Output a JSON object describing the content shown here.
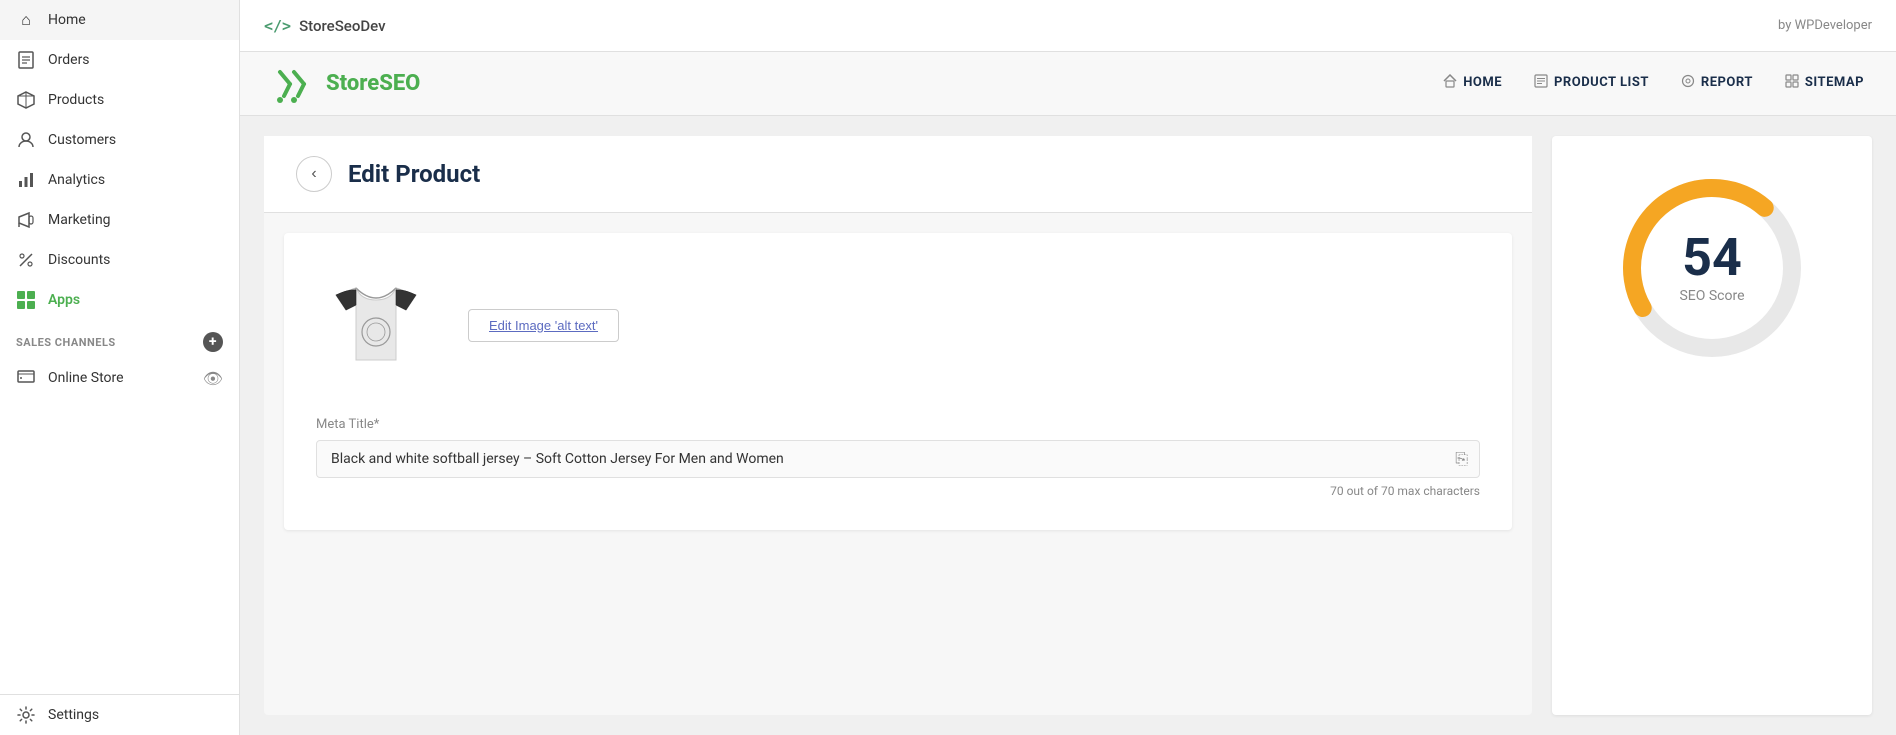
{
  "topbar": {
    "brand_code": "</>",
    "brand_name": "StoreSeoDev",
    "by_text": "by WPDeveloper"
  },
  "plugin_header": {
    "logo_text_dark": "Store",
    "logo_text_green": "SEO",
    "nav_items": [
      {
        "id": "home",
        "label": "HOME",
        "icon": "🏠"
      },
      {
        "id": "product_list",
        "label": "PRODUCT LIST",
        "icon": "☰"
      },
      {
        "id": "report",
        "label": "REPORT",
        "icon": "◎"
      },
      {
        "id": "sitemap",
        "label": "SITEMAP",
        "icon": "⊞"
      }
    ]
  },
  "sidebar": {
    "items": [
      {
        "id": "home",
        "label": "Home",
        "icon": "⌂"
      },
      {
        "id": "orders",
        "label": "Orders",
        "icon": "📋"
      },
      {
        "id": "products",
        "label": "Products",
        "icon": "🏷"
      },
      {
        "id": "customers",
        "label": "Customers",
        "icon": "👤"
      },
      {
        "id": "analytics",
        "label": "Analytics",
        "icon": "📊"
      },
      {
        "id": "marketing",
        "label": "Marketing",
        "icon": "📢"
      },
      {
        "id": "discounts",
        "label": "Discounts",
        "icon": "🏷"
      },
      {
        "id": "apps",
        "label": "Apps",
        "icon": "apps",
        "active": true
      }
    ],
    "sales_channels_label": "SALES CHANNELS",
    "online_store_label": "Online Store",
    "settings_label": "Settings"
  },
  "edit_product": {
    "back_icon": "‹",
    "title": "Edit Product",
    "edit_image_alt_btn": "Edit Image 'alt text'",
    "meta_title_label": "Meta Title*",
    "meta_title_value": "Black and white softball jersey – Soft Cotton Jersey For Men and Women",
    "char_count_text": "70 out of 70 max characters"
  },
  "seo_score": {
    "score": "54",
    "label": "SEO Score"
  }
}
